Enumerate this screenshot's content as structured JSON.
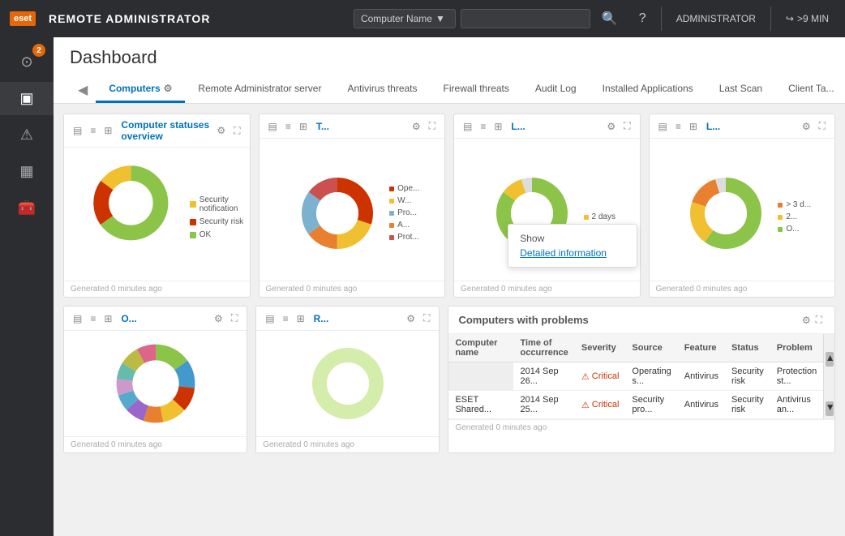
{
  "navbar": {
    "logo": "eset",
    "title": "REMOTE ADMINISTRATOR",
    "computer_name_label": "Computer Name",
    "search_placeholder": "",
    "user": "ADMINISTRATOR",
    "session": ">9 MIN"
  },
  "sidebar": {
    "badge": "2",
    "items": [
      {
        "id": "dashboard",
        "icon": "⊙",
        "label": "Dashboard"
      },
      {
        "id": "computers",
        "icon": "▣",
        "label": "Computers"
      },
      {
        "id": "alerts",
        "icon": "⚠",
        "label": "Alerts"
      },
      {
        "id": "reports",
        "icon": "▦",
        "label": "Reports"
      },
      {
        "id": "tools",
        "icon": "⚙",
        "label": "Tools"
      }
    ]
  },
  "page": {
    "title": "Dashboard"
  },
  "tabs": [
    {
      "id": "computers",
      "label": "Computers",
      "active": true,
      "has_settings": true
    },
    {
      "id": "remote-admin",
      "label": "Remote Administrator server",
      "active": false
    },
    {
      "id": "antivirus",
      "label": "Antivirus threats",
      "active": false
    },
    {
      "id": "firewall",
      "label": "Firewall threats",
      "active": false
    },
    {
      "id": "audit",
      "label": "Audit Log",
      "active": false
    },
    {
      "id": "installed-apps",
      "label": "Installed Applications",
      "active": false
    },
    {
      "id": "last-scan",
      "label": "Last Scan",
      "active": false
    },
    {
      "id": "client-tasks",
      "label": "Client Ta...",
      "active": false
    }
  ],
  "widgets": {
    "row1": [
      {
        "id": "computer-statuses",
        "title": "Computer statuses overview",
        "footer": "Generated 0 minutes ago",
        "legend": [
          {
            "label": "Security notification",
            "color": "#f0c030"
          },
          {
            "label": "Security risk",
            "color": "#cc3300"
          },
          {
            "label": "OK",
            "color": "#8cc44a"
          }
        ],
        "donut": {
          "segments": [
            {
              "value": 65,
              "color": "#8cc44a"
            },
            {
              "value": 20,
              "color": "#cc3300"
            },
            {
              "value": 15,
              "color": "#f0c030"
            }
          ]
        }
      },
      {
        "id": "widget2",
        "title": "T...",
        "footer": "Generated 0 minutes ago",
        "legend": [
          {
            "label": "Ope...",
            "color": "#cc3300"
          },
          {
            "label": "W...",
            "color": "#f0c030"
          },
          {
            "label": "Pro...",
            "color": "#7cb2d0"
          },
          {
            "label": "A...",
            "color": "#e88030"
          },
          {
            "label": "Prot...",
            "color": "#cc5050"
          }
        ],
        "donut": {
          "segments": [
            {
              "value": 30,
              "color": "#cc3300"
            },
            {
              "value": 20,
              "color": "#f0c030"
            },
            {
              "value": 15,
              "color": "#e88030"
            },
            {
              "value": 20,
              "color": "#7cb2d0"
            },
            {
              "value": 15,
              "color": "#cc5050"
            }
          ]
        }
      },
      {
        "id": "widget3",
        "title": "L...",
        "footer": "Generated 0 minutes ago",
        "tooltip": true,
        "tooltip_show": "Show",
        "tooltip_link": "Detailed information",
        "legend": [
          {
            "label": "2 days",
            "color": "#f0c030"
          }
        ],
        "donut": {
          "segments": [
            {
              "value": 85,
              "color": "#8cc44a"
            },
            {
              "value": 10,
              "color": "#f0c030"
            },
            {
              "value": 5,
              "color": "#ddd"
            }
          ]
        }
      },
      {
        "id": "widget4",
        "title": "L...",
        "footer": "Generated 0 minutes ago",
        "legend": [
          {
            "label": "> 3 d...",
            "color": "#e88030"
          },
          {
            "label": "2...",
            "color": "#f0c030"
          },
          {
            "label": "O...",
            "color": "#8cc44a"
          }
        ],
        "donut": {
          "segments": [
            {
              "value": 60,
              "color": "#8cc44a"
            },
            {
              "value": 20,
              "color": "#f0c030"
            },
            {
              "value": 15,
              "color": "#e88030"
            },
            {
              "value": 5,
              "color": "#ddd"
            }
          ]
        }
      }
    ],
    "row2": [
      {
        "id": "widget5",
        "title": "O...",
        "footer": "Generated 0 minutes ago",
        "donut": {
          "segments": [
            {
              "value": 15,
              "color": "#8cc44a"
            },
            {
              "value": 12,
              "color": "#4499cc"
            },
            {
              "value": 10,
              "color": "#cc3300"
            },
            {
              "value": 10,
              "color": "#f0c030"
            },
            {
              "value": 8,
              "color": "#e88030"
            },
            {
              "value": 8,
              "color": "#9966cc"
            },
            {
              "value": 7,
              "color": "#55aacc"
            },
            {
              "value": 7,
              "color": "#cc99cc"
            },
            {
              "value": 7,
              "color": "#66bbaa"
            },
            {
              "value": 8,
              "color": "#bbbb44"
            },
            {
              "value": 8,
              "color": "#dd6688"
            }
          ]
        }
      },
      {
        "id": "widget6",
        "title": "R...",
        "footer": "Generated 0 minutes ago",
        "donut": {
          "segments": [
            {
              "value": 100,
              "color": "#8cc44a"
            }
          ]
        }
      }
    ],
    "problems": {
      "title": "Computers with problems",
      "columns": [
        "Computer name",
        "Time of occurrence",
        "Severity",
        "Source",
        "Feature",
        "Status",
        "Problem"
      ],
      "rows": [
        {
          "computer": "",
          "time": "2014 Sep 26...",
          "severity": "Critical",
          "source": "Operating s...",
          "feature": "Antivirus",
          "status": "Security risk",
          "problem": "Protection st..."
        },
        {
          "computer": "ESET Shared...",
          "time": "2014 Sep 25...",
          "severity": "Critical",
          "source": "Security pro...",
          "feature": "Antivirus",
          "status": "Security risk",
          "problem": "Antivirus an..."
        }
      ]
    }
  }
}
